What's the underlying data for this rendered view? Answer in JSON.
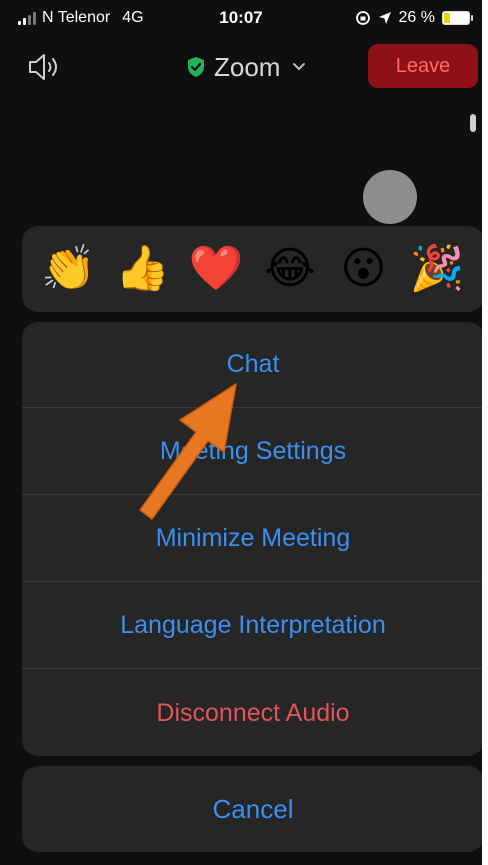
{
  "status_bar": {
    "carrier": "N Telenor",
    "network": "4G",
    "time": "10:07",
    "battery": "26 %",
    "battery_level": 0.26
  },
  "top_bar": {
    "meeting_title": "Zoom",
    "leave_label": "Leave"
  },
  "reactions": [
    {
      "icon": "clapping-hands-icon",
      "glyph": "👏"
    },
    {
      "icon": "thumbs-up-icon",
      "glyph": "👍"
    },
    {
      "icon": "heart-icon",
      "glyph": "❤️"
    },
    {
      "icon": "tears-of-joy-icon",
      "glyph": "😂"
    },
    {
      "icon": "surprised-face-icon",
      "glyph": "😮"
    },
    {
      "icon": "party-popper-icon",
      "glyph": "🎉"
    }
  ],
  "menu": {
    "items": [
      {
        "label": "Chat"
      },
      {
        "label": "Meeting Settings"
      },
      {
        "label": "Minimize Meeting"
      },
      {
        "label": "Language Interpretation"
      },
      {
        "label": "Disconnect Audio"
      }
    ],
    "cancel_label": "Cancel"
  },
  "colors": {
    "accent": "#3b8ff0",
    "danger": "#e0545b",
    "leave_bg": "#8e1118",
    "shield": "#21b356",
    "annotation_arrow": "#e87722"
  }
}
